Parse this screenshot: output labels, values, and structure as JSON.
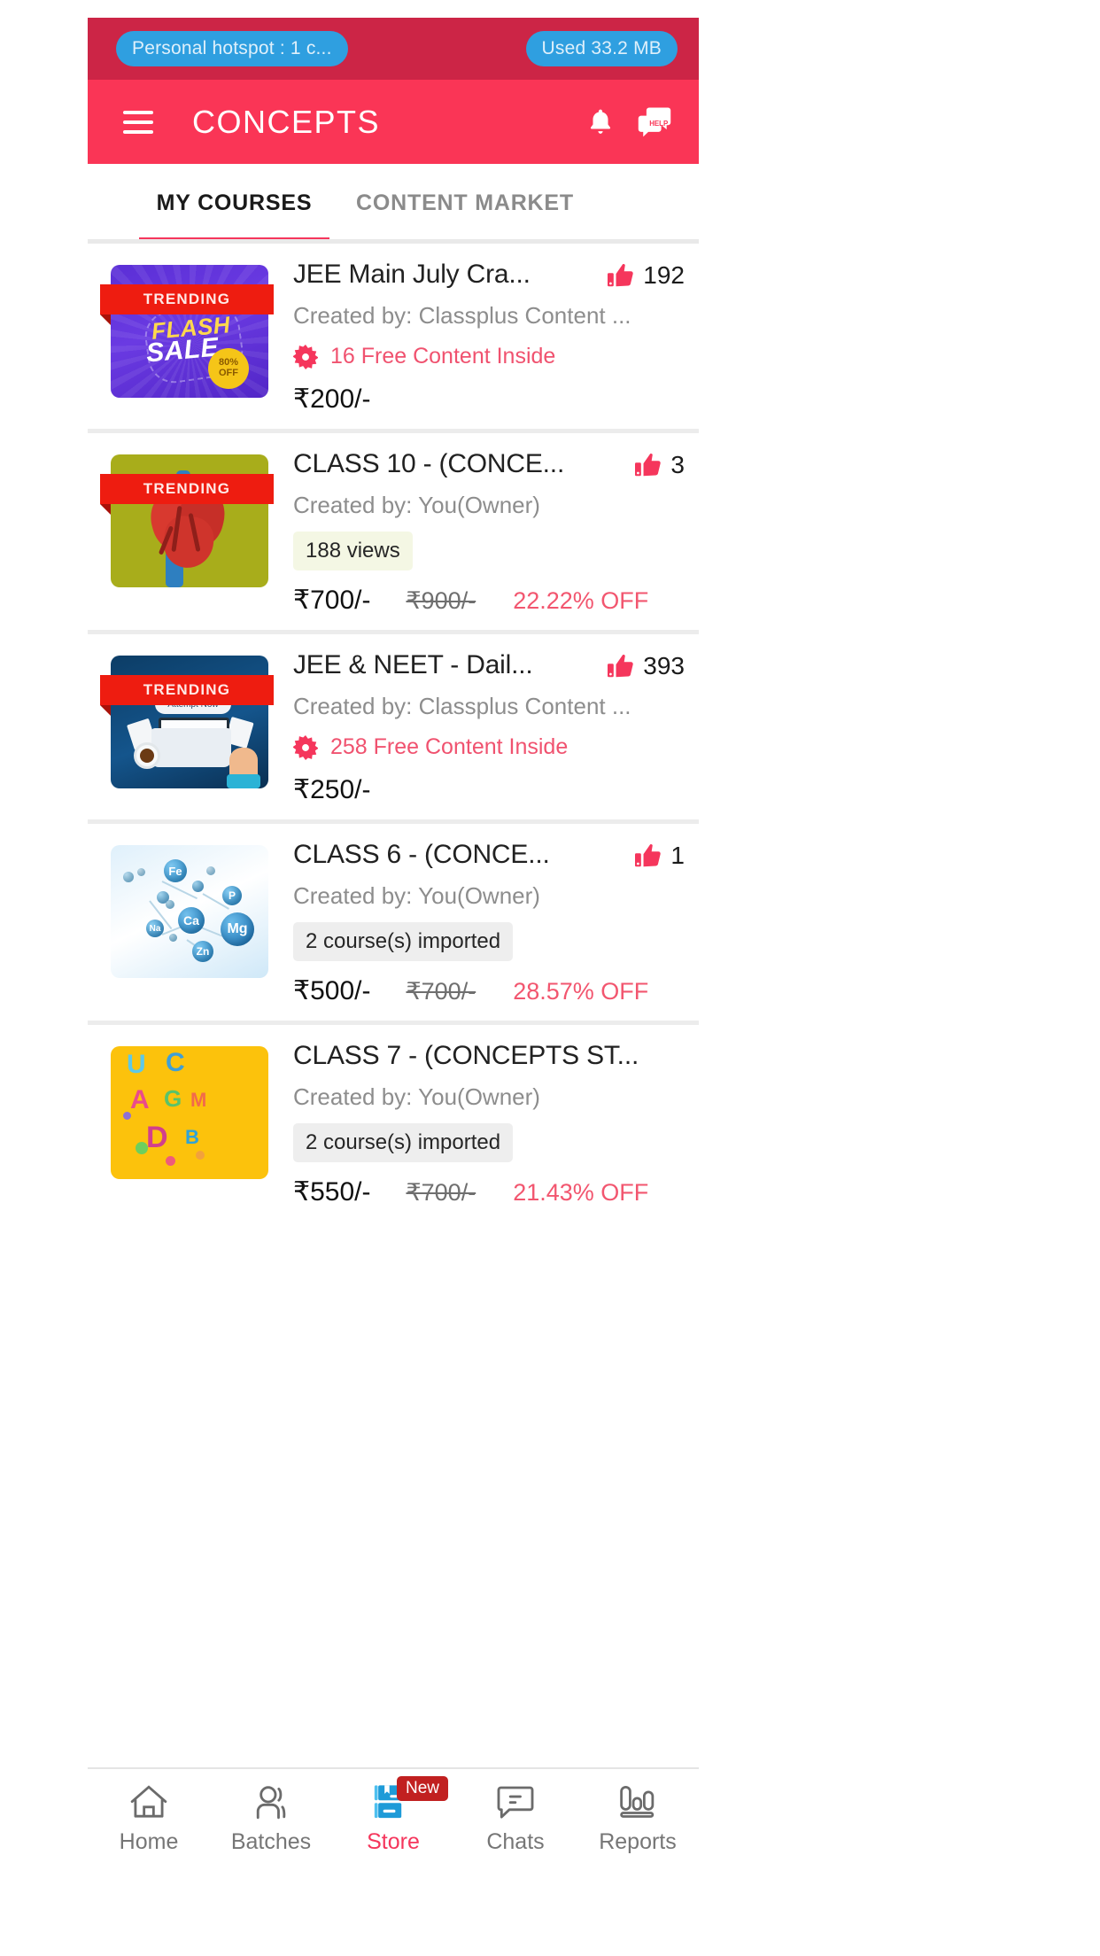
{
  "statusbar": {
    "hotspot_chip": "Personal hotspot : 1 c...",
    "data_chip": "Used  33.2 MB"
  },
  "appbar": {
    "title": "CONCEPTS",
    "menu_icon": "hamburger-menu-icon",
    "bell_icon": "notification-bell-icon",
    "help_icon": "help-chat-icon",
    "help_icon_label": "HELP",
    "background_color": "#fa3556"
  },
  "tabs": [
    {
      "label": "MY COURSES",
      "active": true
    },
    {
      "label": "CONTENT MARKET",
      "active": false
    }
  ],
  "courses": [
    {
      "badge": "TRENDING",
      "title": "JEE Main July Cra...",
      "likes": "192",
      "creator": "Created by: Classplus Content ...",
      "free_content": "16 Free Content Inside",
      "price": "₹200/-",
      "old_price": "",
      "discount": "",
      "pill": "",
      "thumb_type": "flash-sale",
      "thumb_texts": [
        "FLASH",
        "SALE",
        "80%",
        "OFF"
      ]
    },
    {
      "badge": "TRENDING",
      "title": "CLASS 10 - (CONCE...",
      "likes": "3",
      "creator": "Created by: You(Owner)",
      "free_content": "",
      "price": "₹700/-",
      "old_price": "₹900/-",
      "discount": "22.22% OFF",
      "pill": "188  views",
      "pill_style": "views",
      "thumb_type": "heart"
    },
    {
      "badge": "TRENDING",
      "title": "JEE & NEET - Dail...",
      "likes": "393",
      "creator": "Created by: Classplus Content ...",
      "free_content": "258 Free Content Inside",
      "price": "₹250/-",
      "old_price": "",
      "discount": "",
      "pill": "",
      "thumb_type": "attempt-now",
      "thumb_texts": [
        "Attempt Now"
      ]
    },
    {
      "badge": "",
      "title": "CLASS 6 -  (CONCE...",
      "likes": "1",
      "creator": "Created by: You(Owner)",
      "free_content": "",
      "price": "₹500/-",
      "old_price": "₹700/-",
      "discount": "28.57% OFF",
      "pill": "2 course(s) imported",
      "pill_style": "imported",
      "thumb_type": "molecules",
      "thumb_texts": [
        "Fe",
        "P",
        "Ca",
        "Mg",
        "Na",
        "Zn"
      ]
    },
    {
      "badge": "",
      "title": "CLASS 7 -  (CONCEPTS ST...",
      "likes": "",
      "creator": "Created by: You(Owner)",
      "free_content": "",
      "price": "₹550/-",
      "old_price": "₹700/-",
      "discount": "21.43% OFF",
      "pill": "2 course(s) imported",
      "pill_style": "imported",
      "thumb_type": "abc-letters",
      "thumb_texts": [
        "U",
        "C",
        "A",
        "G",
        "M",
        "D",
        "B"
      ]
    }
  ],
  "bottom_nav": [
    {
      "label": "Home",
      "icon": "home-icon",
      "active": false,
      "badge": ""
    },
    {
      "label": "Batches",
      "icon": "people-icon",
      "active": false,
      "badge": ""
    },
    {
      "label": "Store",
      "icon": "store-books-icon",
      "active": true,
      "badge": "New"
    },
    {
      "label": "Chats",
      "icon": "chat-bubble-icon",
      "active": false,
      "badge": ""
    },
    {
      "label": "Reports",
      "icon": "bar-chart-icon",
      "active": false,
      "badge": ""
    }
  ],
  "colors": {
    "brand_red": "#fa3556",
    "status_red": "#cc2546",
    "accent_pink": "#f5365c",
    "chip_blue": "#2f9fe0",
    "ribbon_red": "#ee1c10"
  }
}
